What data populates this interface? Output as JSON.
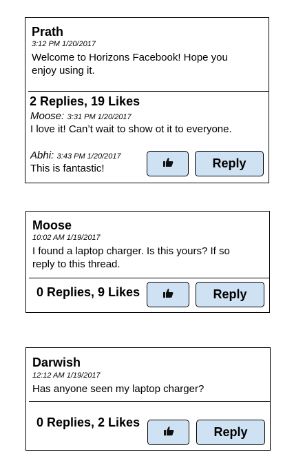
{
  "posts": [
    {
      "author": "Prath",
      "timestamp": "3:12 PM 1/20/2017",
      "text": "Welcome to Horizons Facebook! Hope you enjoy using it.",
      "summary": "2 Replies, 19 Likes",
      "replies": [
        {
          "author": "Moose:",
          "timestamp": "3:31 PM 1/20/2017",
          "text": "I love it! Can’t wait to show ot it to everyone."
        },
        {
          "author": "Abhi:",
          "timestamp": "3:43 PM 1/20/2017",
          "text": "This is fantastic!"
        }
      ],
      "reply_label": "Reply",
      "like_icon": "thumbs-up-icon"
    },
    {
      "author": "Moose",
      "timestamp": "10:02 AM 1/19/2017",
      "text": "I found a laptop charger. Is this yours? If so reply to this thread.",
      "summary": "0 Replies, 9 Likes",
      "reply_label": "Reply",
      "like_icon": "thumbs-up-icon"
    },
    {
      "author": "Darwish",
      "timestamp": "12:12 AM 1/19/2017",
      "text": "Has anyone seen my laptop charger?",
      "summary": "0 Replies, 2 Likes",
      "reply_label": "Reply",
      "like_icon": "thumbs-up-icon"
    }
  ],
  "colors": {
    "button_bg": "#cfe2f3",
    "border": "#000000"
  }
}
